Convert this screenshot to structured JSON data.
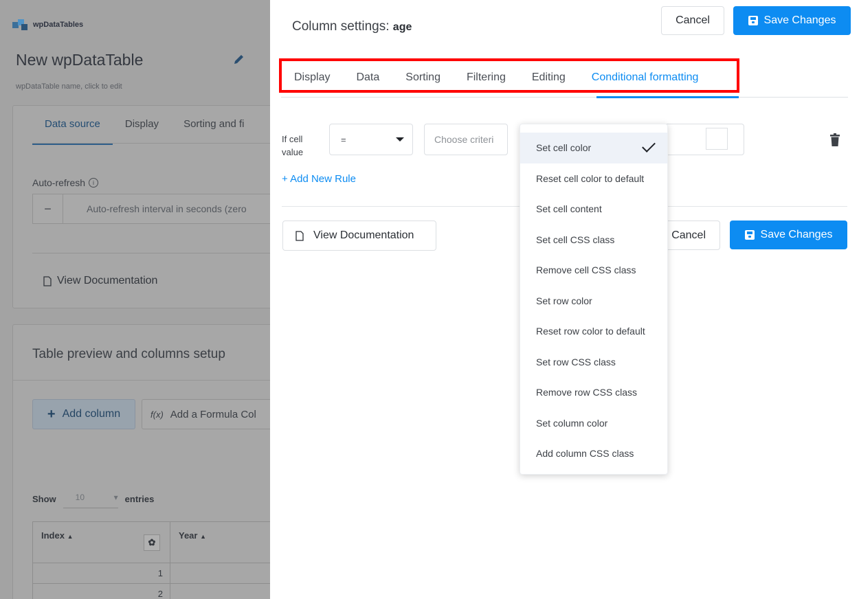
{
  "background": {
    "logo_text": "wpDataTables",
    "table_title": "New wpDataTable",
    "edit_hint": "wpDataTable name, click to edit",
    "tabs": [
      {
        "label": "Data source"
      },
      {
        "label": "Display"
      },
      {
        "label": "Sorting and fi"
      }
    ],
    "auto_refresh_label": "Auto-refresh",
    "auto_refresh_placeholder": "Auto-refresh interval in seconds (zero",
    "view_doc_label": "View Documentation",
    "preview_title": "Table preview and columns setup",
    "add_column_label": "Add column",
    "add_formula_label": "Add a Formula Col",
    "show_label": "Show",
    "show_value": "10",
    "entries_label": "entries",
    "table_headers": [
      "Index",
      "Year"
    ],
    "table_rows": [
      "1",
      "2"
    ]
  },
  "panel": {
    "title": "Column settings:",
    "column_name": "age",
    "cancel_label": "Cancel",
    "save_label": "Save Changes",
    "tabs": [
      {
        "label": "Display"
      },
      {
        "label": "Data"
      },
      {
        "label": "Sorting"
      },
      {
        "label": "Filtering"
      },
      {
        "label": "Editing"
      },
      {
        "label": "Conditional formatting"
      }
    ],
    "active_tab": "Conditional formatting",
    "rule": {
      "label_line1": "If cell",
      "label_line2": "value",
      "operator": "=",
      "criteria_placeholder": "Choose criteri"
    },
    "add_rule_label": "+ Add New Rule",
    "view_doc_label": "View Documentation",
    "bottom_cancel_label": "Cancel",
    "bottom_save_label": "Save Changes"
  },
  "dropdown": {
    "selected": "Set cell color",
    "options": [
      "Set cell color",
      "Reset cell color to default",
      "Set cell content",
      "Set cell CSS class",
      "Remove cell CSS class",
      "Set row color",
      "Reset row color to default",
      "Set row CSS class",
      "Remove row CSS class",
      "Set column color",
      "Add column CSS class"
    ]
  },
  "colors": {
    "accent": "#0d8cf2",
    "highlight": "#ff0000"
  }
}
